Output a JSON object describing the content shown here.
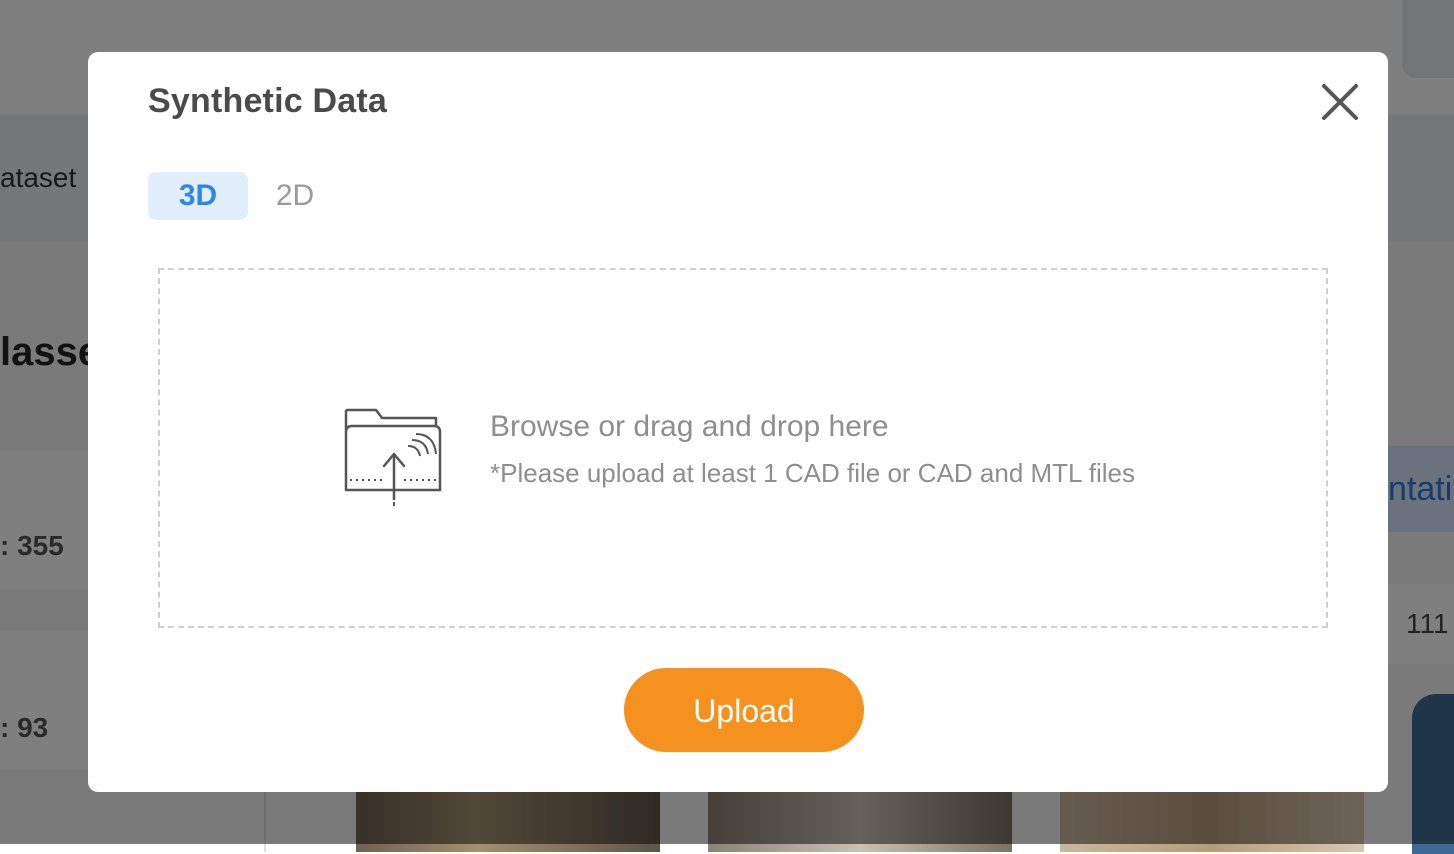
{
  "background": {
    "tab_text": "ataset",
    "section_heading": "lasses",
    "card_count_1": ": 355",
    "card_count_2": ": 93",
    "right_chip_text": "ntati",
    "right_number": "111"
  },
  "modal": {
    "title": "Synthetic Data",
    "close_icon": "close-icon",
    "tabs": [
      {
        "label": "3D",
        "active": true
      },
      {
        "label": "2D",
        "active": false
      }
    ],
    "dropzone": {
      "icon": "folder-upload-icon",
      "main_text": "Browse or drag and drop here",
      "sub_text": "*Please upload at least 1 CAD file or CAD and MTL files"
    },
    "upload_label": "Upload"
  },
  "colors": {
    "accent_orange": "#f5921f",
    "tab_active_bg": "#e2eefc",
    "tab_active_text": "#2d86e8",
    "overlay": "rgba(0,0,0,0.5)"
  }
}
